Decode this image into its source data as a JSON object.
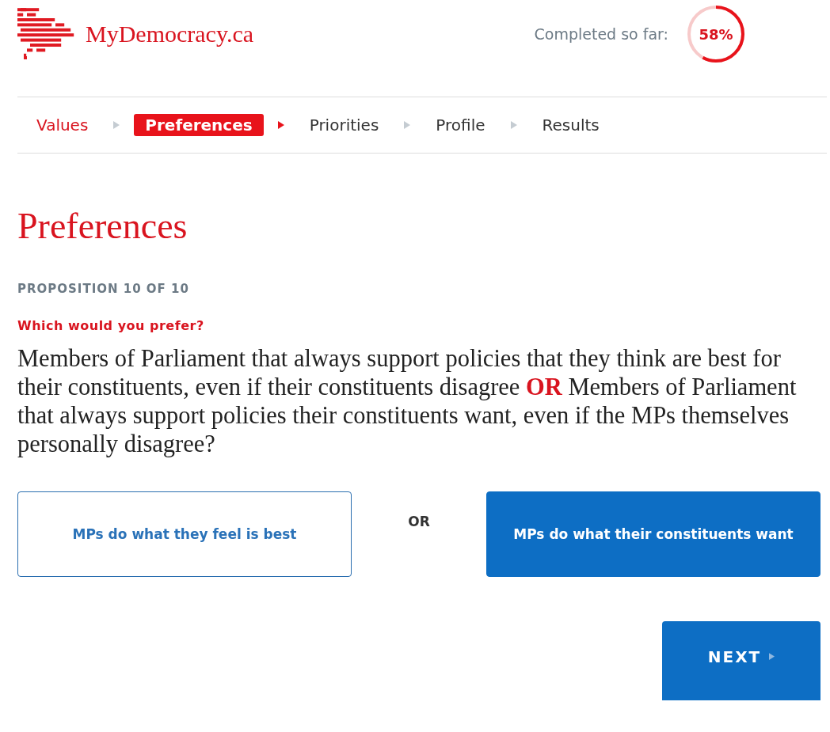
{
  "header": {
    "site_name": "MyDemocracy.ca",
    "progress_label": "Completed so far:",
    "progress_text": "58%",
    "progress": {
      "level": 0.58
    }
  },
  "steps": [
    {
      "label": "Values",
      "selected": false,
      "done": true
    },
    {
      "label": "Preferences",
      "selected": true,
      "done": false
    },
    {
      "label": "Priorities",
      "selected": false,
      "done": false
    },
    {
      "label": "Profile",
      "selected": false,
      "done": false
    },
    {
      "label": "Results",
      "selected": false,
      "done": false
    }
  ],
  "page_title": "Preferences",
  "proposition_counter": "PROPOSITION 10 OF 10",
  "prompt": "Which would you prefer?",
  "question": "Members of Parliament that always support policies that they think are best for their constituents, even if their constituents disagree **OR** Members of Parliament that always support policies their constituents want, even if the MPs themselves personally disagree?",
  "options": [
    {
      "label": "MPs do what they feel is best",
      "selected": false
    },
    {
      "label": "MPs do what their constituents want",
      "selected": true
    }
  ],
  "separator": "OR",
  "next_button": "NEXT"
}
